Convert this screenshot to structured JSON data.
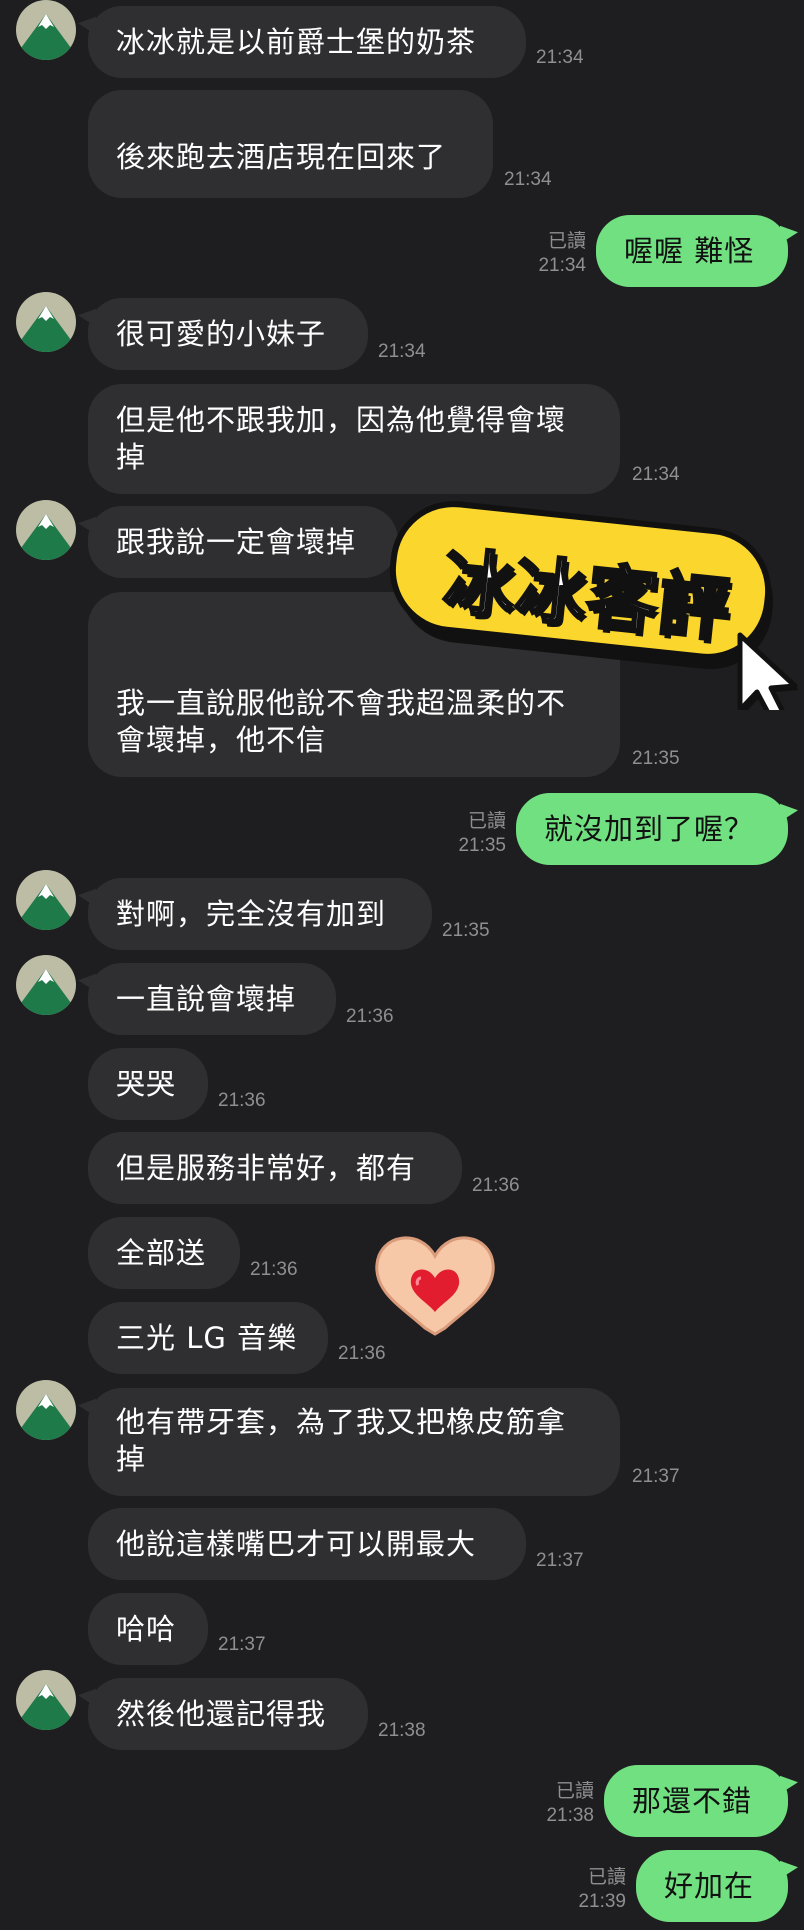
{
  "messages": [
    {
      "text": "冰冰就是以前爵士堡的奶茶",
      "time": "21:34"
    },
    {
      "text": "後來跑去酒店現在回來了",
      "time": "21:34"
    },
    {
      "text": "喔喔 難怪",
      "time": "21:34",
      "read": "已讀"
    },
    {
      "text": "很可愛的小妹子",
      "time": "21:34"
    },
    {
      "text": "但是他不跟我加，因為他覺得會壞\n掉",
      "time": "21:34"
    },
    {
      "text": "跟我說一定會壞掉",
      "time": ""
    },
    {
      "text": "我一直說服他說不會我超溫柔的不\n會壞掉，他不信",
      "time": "21:35"
    },
    {
      "text": "就沒加到了喔？",
      "time": "21:35",
      "read": "已讀"
    },
    {
      "text": "對啊，完全沒有加到",
      "time": "21:35"
    },
    {
      "text": "一直說會壞掉",
      "time": "21:36"
    },
    {
      "text": "哭哭",
      "time": "21:36"
    },
    {
      "text": "但是服務非常好，都有",
      "time": "21:36"
    },
    {
      "text": "全部送",
      "time": "21:36"
    },
    {
      "text": "三光 LG 音樂",
      "time": "21:36"
    },
    {
      "text": "他有帶牙套，為了我又把橡皮筋拿\n掉",
      "time": "21:37"
    },
    {
      "text": "他說這樣嘴巴才可以開最大",
      "time": "21:37"
    },
    {
      "text": "哈哈",
      "time": "21:37"
    },
    {
      "text": "然後他還記得我",
      "time": "21:38"
    },
    {
      "text": "那還不錯",
      "time": "21:38",
      "read": "已讀"
    },
    {
      "text": "好加在",
      "time": "21:39",
      "read": "已讀"
    }
  ],
  "sticker": {
    "text": "冰冰客評",
    "colors": {
      "fill": "#fbd62c",
      "stroke": "#111111"
    }
  },
  "icons": {
    "avatar": "mountain-avatar-icon",
    "cursor": "mouse-cursor-icon",
    "heart": "heart-hands-emoji"
  },
  "colors": {
    "background": "#1e1e20",
    "incoming": "#2f2f31",
    "outgoing": "#71e081",
    "timestamp": "#8f8f93"
  }
}
